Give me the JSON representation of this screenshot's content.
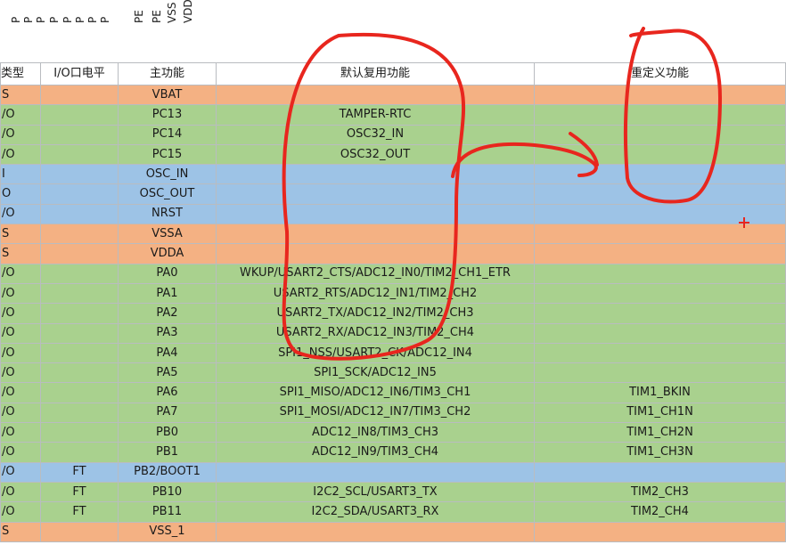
{
  "top_labels": [
    "P",
    "P",
    "P",
    "P",
    "P",
    "P",
    "P",
    "P",
    "PE",
    "PE",
    "VSS",
    "VDD"
  ],
  "table": {
    "headers": {
      "type": "类型",
      "io_level": "I/O口电平",
      "main_function": "主功能",
      "default_alt": "默认复用功能",
      "remap": "重定义功能"
    },
    "rows": [
      {
        "type": "S",
        "io": "",
        "main": "VBAT",
        "alt": "",
        "remap": "",
        "kind": "power"
      },
      {
        "type": "/O",
        "io": "",
        "main": "PC13",
        "alt": "TAMPER-RTC",
        "remap": "",
        "kind": "io"
      },
      {
        "type": "/O",
        "io": "",
        "main": "PC14",
        "alt": "OSC32_IN",
        "remap": "",
        "kind": "io"
      },
      {
        "type": "/O",
        "io": "",
        "main": "PC15",
        "alt": "OSC32_OUT",
        "remap": "",
        "kind": "io"
      },
      {
        "type": "I",
        "io": "",
        "main": "OSC_IN",
        "alt": "",
        "remap": "",
        "kind": "special"
      },
      {
        "type": "O",
        "io": "",
        "main": "OSC_OUT",
        "alt": "",
        "remap": "",
        "kind": "special"
      },
      {
        "type": "/O",
        "io": "",
        "main": "NRST",
        "alt": "",
        "remap": "",
        "kind": "special"
      },
      {
        "type": "S",
        "io": "",
        "main": "VSSA",
        "alt": "",
        "remap": "",
        "kind": "power"
      },
      {
        "type": "S",
        "io": "",
        "main": "VDDA",
        "alt": "",
        "remap": "",
        "kind": "power"
      },
      {
        "type": "/O",
        "io": "",
        "main": "PA0",
        "alt": "WKUP/USART2_CTS/ADC12_IN0/TIM2_CH1_ETR",
        "remap": "",
        "kind": "io"
      },
      {
        "type": "/O",
        "io": "",
        "main": "PA1",
        "alt": "USART2_RTS/ADC12_IN1/TIM2_CH2",
        "remap": "",
        "kind": "io"
      },
      {
        "type": "/O",
        "io": "",
        "main": "PA2",
        "alt": "USART2_TX/ADC12_IN2/TIM2_CH3",
        "remap": "",
        "kind": "io"
      },
      {
        "type": "/O",
        "io": "",
        "main": "PA3",
        "alt": "USART2_RX/ADC12_IN3/TIM2_CH4",
        "remap": "",
        "kind": "io"
      },
      {
        "type": "/O",
        "io": "",
        "main": "PA4",
        "alt": "SPI1_NSS/USART2_CK/ADC12_IN4",
        "remap": "",
        "kind": "io"
      },
      {
        "type": "/O",
        "io": "",
        "main": "PA5",
        "alt": "SPI1_SCK/ADC12_IN5",
        "remap": "",
        "kind": "io"
      },
      {
        "type": "/O",
        "io": "",
        "main": "PA6",
        "alt": "SPI1_MISO/ADC12_IN6/TIM3_CH1",
        "remap": "TIM1_BKIN",
        "kind": "io"
      },
      {
        "type": "/O",
        "io": "",
        "main": "PA7",
        "alt": "SPI1_MOSI/ADC12_IN7/TIM3_CH2",
        "remap": "TIM1_CH1N",
        "kind": "io"
      },
      {
        "type": "/O",
        "io": "",
        "main": "PB0",
        "alt": "ADC12_IN8/TIM3_CH3",
        "remap": "TIM1_CH2N",
        "kind": "io"
      },
      {
        "type": "/O",
        "io": "",
        "main": "PB1",
        "alt": "ADC12_IN9/TIM3_CH4",
        "remap": "TIM1_CH3N",
        "kind": "io"
      },
      {
        "type": "/O",
        "io": "FT",
        "main": "PB2/BOOT1",
        "alt": "",
        "remap": "",
        "kind": "special"
      },
      {
        "type": "/O",
        "io": "FT",
        "main": "PB10",
        "alt": "I2C2_SCL/USART3_TX",
        "remap": "TIM2_CH3",
        "kind": "io"
      },
      {
        "type": "/O",
        "io": "FT",
        "main": "PB11",
        "alt": "I2C2_SDA/USART3_RX",
        "remap": "TIM2_CH4",
        "kind": "io"
      },
      {
        "type": "S",
        "io": "",
        "main": "VSS_1",
        "alt": "",
        "remap": "",
        "kind": "power"
      }
    ]
  },
  "colors": {
    "power": "#f4b183",
    "io": "#a9d18e",
    "special": "#9dc3e6",
    "annotation": "#e8261e"
  }
}
